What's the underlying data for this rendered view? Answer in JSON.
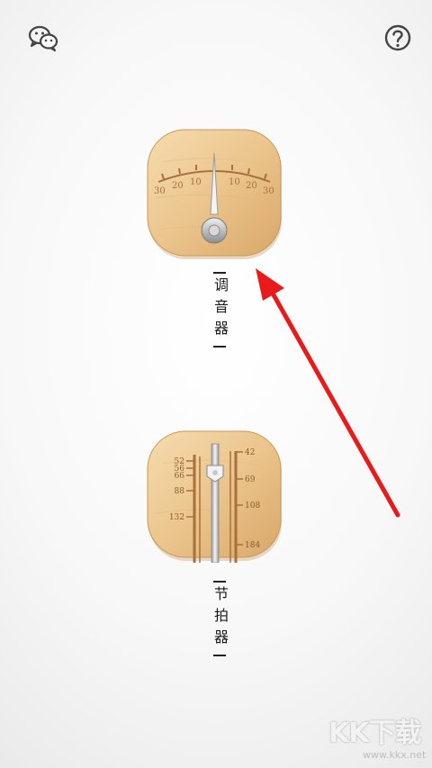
{
  "header": {
    "left_icon": "wechat-icon",
    "right_icon": "help-icon"
  },
  "tuner": {
    "label": "调音器",
    "scale_labels": [
      "30",
      "20",
      "10",
      "10",
      "20",
      "30"
    ],
    "needle_value": 0
  },
  "metronome": {
    "label": "节拍器",
    "left_scale": [
      "52",
      "56",
      "66",
      "88",
      "132"
    ],
    "right_scale": [
      "42",
      "69",
      "108",
      "184"
    ]
  },
  "annotation": {
    "arrow_color": "#e81a1a",
    "target": "tuner"
  },
  "watermark": {
    "logo": "KK下载",
    "url": "www.kkx.net"
  },
  "colors": {
    "wood_light": "#f2d3a0",
    "wood_dark": "#d8a766",
    "scale_brown": "#a8703a"
  }
}
